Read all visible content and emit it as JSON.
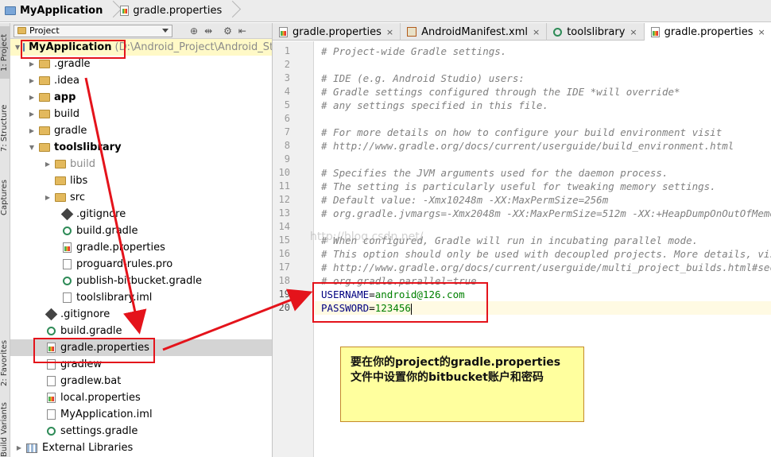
{
  "navbar": {
    "app_name": "MyApplication",
    "file_name": "gradle.properties"
  },
  "tool_stripe": {
    "project": "1: Project",
    "structure": "7: Structure",
    "captures": "Captures",
    "favorites": "2: Favorites",
    "build_variants": "Build Variants"
  },
  "project_panel": {
    "view_label": "Project",
    "root": {
      "name": "MyApplication",
      "path": "(D:\\Android_Project\\Android_Stud"
    },
    "items": [
      {
        "label": ".gradle"
      },
      {
        "label": ".idea"
      },
      {
        "label": "app"
      },
      {
        "label": "build"
      },
      {
        "label": "gradle"
      },
      {
        "label": "toolslibrary"
      },
      {
        "label": "build"
      },
      {
        "label": "libs"
      },
      {
        "label": "src"
      },
      {
        "label": ".gitignore"
      },
      {
        "label": "build.gradle"
      },
      {
        "label": "gradle.properties"
      },
      {
        "label": "proguard-rules.pro"
      },
      {
        "label": "publish-bitbucket.gradle"
      },
      {
        "label": "toolslibrary.iml"
      },
      {
        "label": ".gitignore"
      },
      {
        "label": "build.gradle"
      },
      {
        "label": "gradle.properties"
      },
      {
        "label": "gradlew"
      },
      {
        "label": "gradlew.bat"
      },
      {
        "label": "local.properties"
      },
      {
        "label": "MyApplication.iml"
      },
      {
        "label": "settings.gradle"
      },
      {
        "label": "External Libraries"
      }
    ]
  },
  "tabs": [
    {
      "label": "gradle.properties",
      "close": "×"
    },
    {
      "label": "AndroidManifest.xml",
      "close": "×"
    },
    {
      "label": "toolslibrary",
      "close": "×"
    },
    {
      "label": "gradle.properties",
      "close": "×"
    }
  ],
  "editor": {
    "line_numbers": [
      "1",
      "2",
      "3",
      "4",
      "5",
      "6",
      "7",
      "8",
      "9",
      "10",
      "11",
      "12",
      "13",
      "14",
      "15",
      "16",
      "17",
      "18",
      "19",
      "20"
    ],
    "lines": [
      "# Project-wide Gradle settings.",
      "",
      "# IDE (e.g. Android Studio) users:",
      "# Gradle settings configured through the IDE *will override*",
      "# any settings specified in this file.",
      "",
      "# For more details on how to configure your build environment visit",
      "# http://www.gradle.org/docs/current/userguide/build_environment.html",
      "",
      "# Specifies the JVM arguments used for the daemon process.",
      "# The setting is particularly useful for tweaking memory settings.",
      "# Default value: -Xmx10248m -XX:MaxPermSize=256m",
      "# org.gradle.jvmargs=-Xmx2048m -XX:MaxPermSize=512m -XX:+HeapDumpOnOutOfMemo",
      "",
      "# When configured, Gradle will run in incubating parallel mode.",
      "# This option should only be used with decoupled projects. More details, visi",
      "# http://www.gradle.org/docs/current/userguide/multi_project_builds.html#sec:",
      "# org.gradle.parallel=true"
    ],
    "username_key": "USERNAME",
    "username_eq": "=",
    "username_value": "android@126.com",
    "password_key": "PASSWORD",
    "password_eq": "=",
    "password_value": "123456"
  },
  "watermark": "http://blog.csdn.net/",
  "note": {
    "line1": "要在你的project的gradle.properties",
    "line2": "文件中设置你的bitbucket账户和密码"
  },
  "colors": {
    "annotation_red": "#e4131b",
    "note_bg": "#ffff9e",
    "comment_gray": "#808080",
    "value_green": "#008000",
    "key_navy": "#000080"
  }
}
